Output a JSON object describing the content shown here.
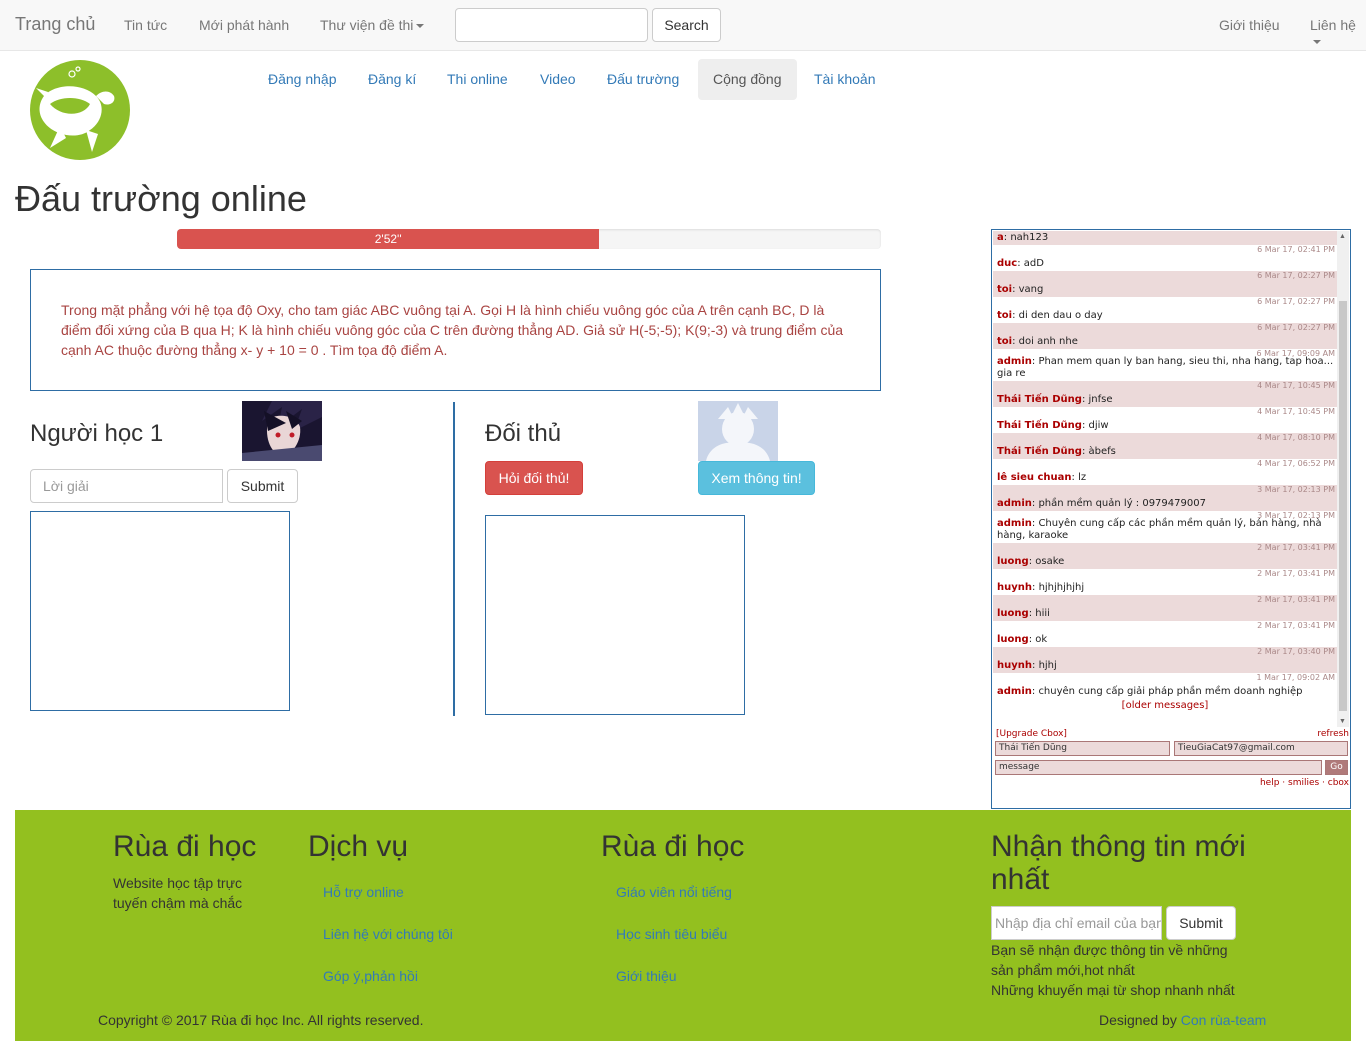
{
  "navbar": {
    "brand": "Trang chủ",
    "links": [
      "Tin tức",
      "Mới phát hành",
      "Thư viện đề thi"
    ],
    "search_button": "Search",
    "right_links": [
      "Giới thiệu",
      "Liên hệ"
    ]
  },
  "pills": [
    "Đăng nhập",
    "Đăng kí",
    "Thi online",
    "Video",
    "Đấu trường",
    "Cộng đồng",
    "Tài khoản"
  ],
  "active_pill": "Cộng đồng",
  "page_title": "Đấu trường online",
  "timer": {
    "label": "2'52''",
    "fraction": 0.6
  },
  "question": "Trong mặt phẳng với hệ tọa độ Oxy, cho tam giác ABC vuông tại A. Gọi H là hình chiếu vuông góc của A trên cạnh BC, D là điểm đối xứng của B qua H; K là hình chiếu vuông góc của C trên đường thẳng AD. Giả sử H(-5;-5); K(9;-3) và trung điểm của cạnh AC thuộc đường thẳng x- y + 10 = 0 . Tìm tọa độ điểm A.",
  "player": {
    "title": "Người học 1",
    "answer_placeholder": "Lời giải",
    "submit": "Submit"
  },
  "opponent": {
    "title": "Đối thủ",
    "ask_button": "Hỏi đối thủ!",
    "info_button": "Xem thông tin!"
  },
  "cbox": {
    "messages": [
      {
        "date": "",
        "name": "a",
        "text": "nah123"
      },
      {
        "date": "6 Mar 17, 02:41 PM",
        "name": "duc",
        "text": "adD"
      },
      {
        "date": "6 Mar 17, 02:27 PM",
        "name": "toi",
        "text": "vang"
      },
      {
        "date": "6 Mar 17, 02:27 PM",
        "name": "toi",
        "text": "di den dau o day"
      },
      {
        "date": "6 Mar 17, 02:27 PM",
        "name": "toi",
        "text": "doi anh nhe"
      },
      {
        "date": "6 Mar 17, 09:09 AM",
        "name": "admin",
        "text": "Phan mem quan ly ban hang, sieu thi, nha hang, tap hoa... gia re"
      },
      {
        "date": "4 Mar 17, 10:45 PM",
        "name": "Thái Tiến Dũng",
        "text": "jnfse"
      },
      {
        "date": "4 Mar 17, 10:45 PM",
        "name": "Thái Tiến Dũng",
        "text": "djiw"
      },
      {
        "date": "4 Mar 17, 08:10 PM",
        "name": "Thái Tiến Dũng",
        "text": "àbefs"
      },
      {
        "date": "4 Mar 17, 06:52 PM",
        "name": "lê sieu chuan",
        "text": "lz"
      },
      {
        "date": "3 Mar 17, 02:13 PM",
        "name": "admin",
        "text": "phần mềm quản lý : 0979479007"
      },
      {
        "date": "3 Mar 17, 02:13 PM",
        "name": "admin",
        "text": "Chuyên cung cấp các phần mềm quản lý, bán hàng, nhà hàng, karaoke"
      },
      {
        "date": "2 Mar 17, 03:41 PM",
        "name": "luong",
        "text": "osake"
      },
      {
        "date": "2 Mar 17, 03:41 PM",
        "name": "huynh",
        "text": "hjhjhjhjhj"
      },
      {
        "date": "2 Mar 17, 03:41 PM",
        "name": "luong",
        "text": "hiii"
      },
      {
        "date": "2 Mar 17, 03:41 PM",
        "name": "luong",
        "text": "ok"
      },
      {
        "date": "2 Mar 17, 03:40 PM",
        "name": "huynh",
        "text": "hjhj"
      },
      {
        "date": "1 Mar 17, 09:02 AM",
        "name": "admin",
        "text": "chuyên cung cấp giải pháp phần mềm doanh nghiệp"
      }
    ],
    "older": "[older messages]",
    "upgrade": "[Upgrade Cbox]",
    "refresh": "refresh",
    "name_value": "Thái Tiến Dũng",
    "email_value": "TieuGiaCat97@gmail.com",
    "message_value": "message",
    "go": "Go",
    "footer_links": "help · smilies · cbox"
  },
  "footer": {
    "col1": {
      "title": "Rùa đi học",
      "text": "Website học tập trực tuyến chậm mà chắc"
    },
    "col2": {
      "title": "Dịch vụ",
      "links": [
        "Hỗ trợ online",
        "Liên hệ với chúng tôi",
        "Góp ý,phản hồi"
      ]
    },
    "col3": {
      "title": "Rùa đi học",
      "links": [
        "Giáo viên nổi tiếng",
        "Học sinh tiêu biểu",
        "Giới thiệu"
      ]
    },
    "col4": {
      "title": "Nhận thông tin mới nhất",
      "placeholder": "Nhập địa chỉ email của bạn",
      "submit": "Submit",
      "line1": "Bạn sẽ nhận được thông tin về những sản phẩm mới,hot nhất",
      "line2": "Những khuyến mại từ shop nhanh nhất"
    },
    "copyright": "Copyright © 2017 Rùa đi học Inc. All rights reserved.",
    "designed_by": "Designed by",
    "designer": "Con rùa-team"
  },
  "colors": {
    "accent": "#337ab7",
    "danger": "#d9534f",
    "info": "#5bc0de",
    "footer": "#93c01f",
    "logo": "#8dbf2a"
  }
}
